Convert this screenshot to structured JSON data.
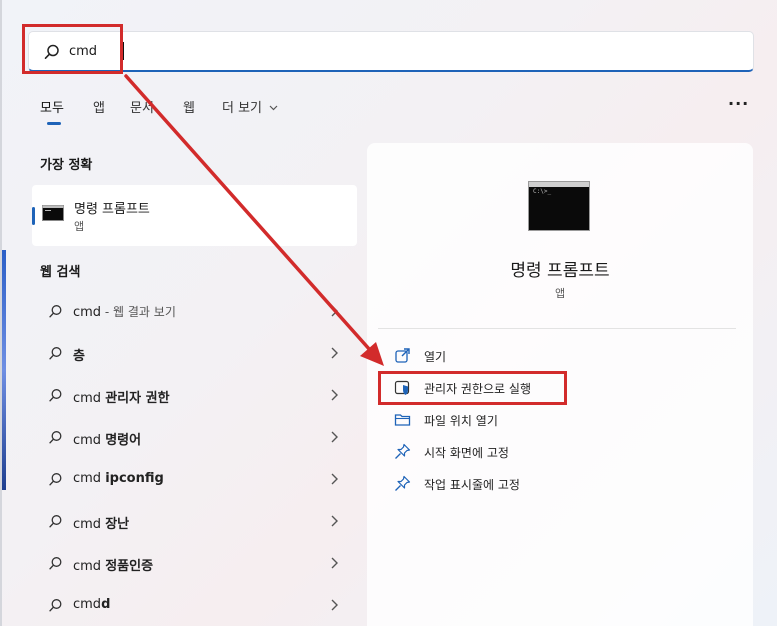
{
  "search": {
    "value": "cmd"
  },
  "tabs": [
    {
      "label": "모두"
    },
    {
      "label": "앱"
    },
    {
      "label": "문서"
    },
    {
      "label": "웹"
    },
    {
      "label": "더 보기"
    }
  ],
  "more_options_label": "···",
  "best_match": {
    "section_title": "가장 정확",
    "title": "명령 프롬프트",
    "subtitle": "앱",
    "icon_text": "C:\\>_"
  },
  "web_search": {
    "section_title": "웹 검색",
    "rows": [
      {
        "prefix": "cmd",
        "bold": "",
        "suffix": " - 웹 결과 보기"
      },
      {
        "prefix": "",
        "bold": "층",
        "suffix": ""
      },
      {
        "prefix": "cmd ",
        "bold": "관리자 권한",
        "suffix": ""
      },
      {
        "prefix": "cmd ",
        "bold": "명령어",
        "suffix": ""
      },
      {
        "prefix": "cmd ",
        "bold": "ipconfig",
        "suffix": ""
      },
      {
        "prefix": "cmd ",
        "bold": "장난",
        "suffix": ""
      },
      {
        "prefix": "cmd ",
        "bold": "정품인증",
        "suffix": ""
      },
      {
        "prefix": "cmd",
        "bold": "d",
        "suffix": ""
      }
    ]
  },
  "preview": {
    "title": "명령 프롬프트",
    "subtitle": "앱",
    "actions": [
      {
        "label": "열기",
        "icon": "open-external-icon"
      },
      {
        "label": "관리자 권한으로 실행",
        "icon": "shield-icon"
      },
      {
        "label": "파일 위치 열기",
        "icon": "folder-icon"
      },
      {
        "label": "시작 화면에 고정",
        "icon": "pin-icon"
      },
      {
        "label": "작업 표시줄에 고정",
        "icon": "pin-icon"
      }
    ]
  },
  "colors": {
    "accent": "#1e63b8",
    "highlight": "#d22b2b"
  }
}
